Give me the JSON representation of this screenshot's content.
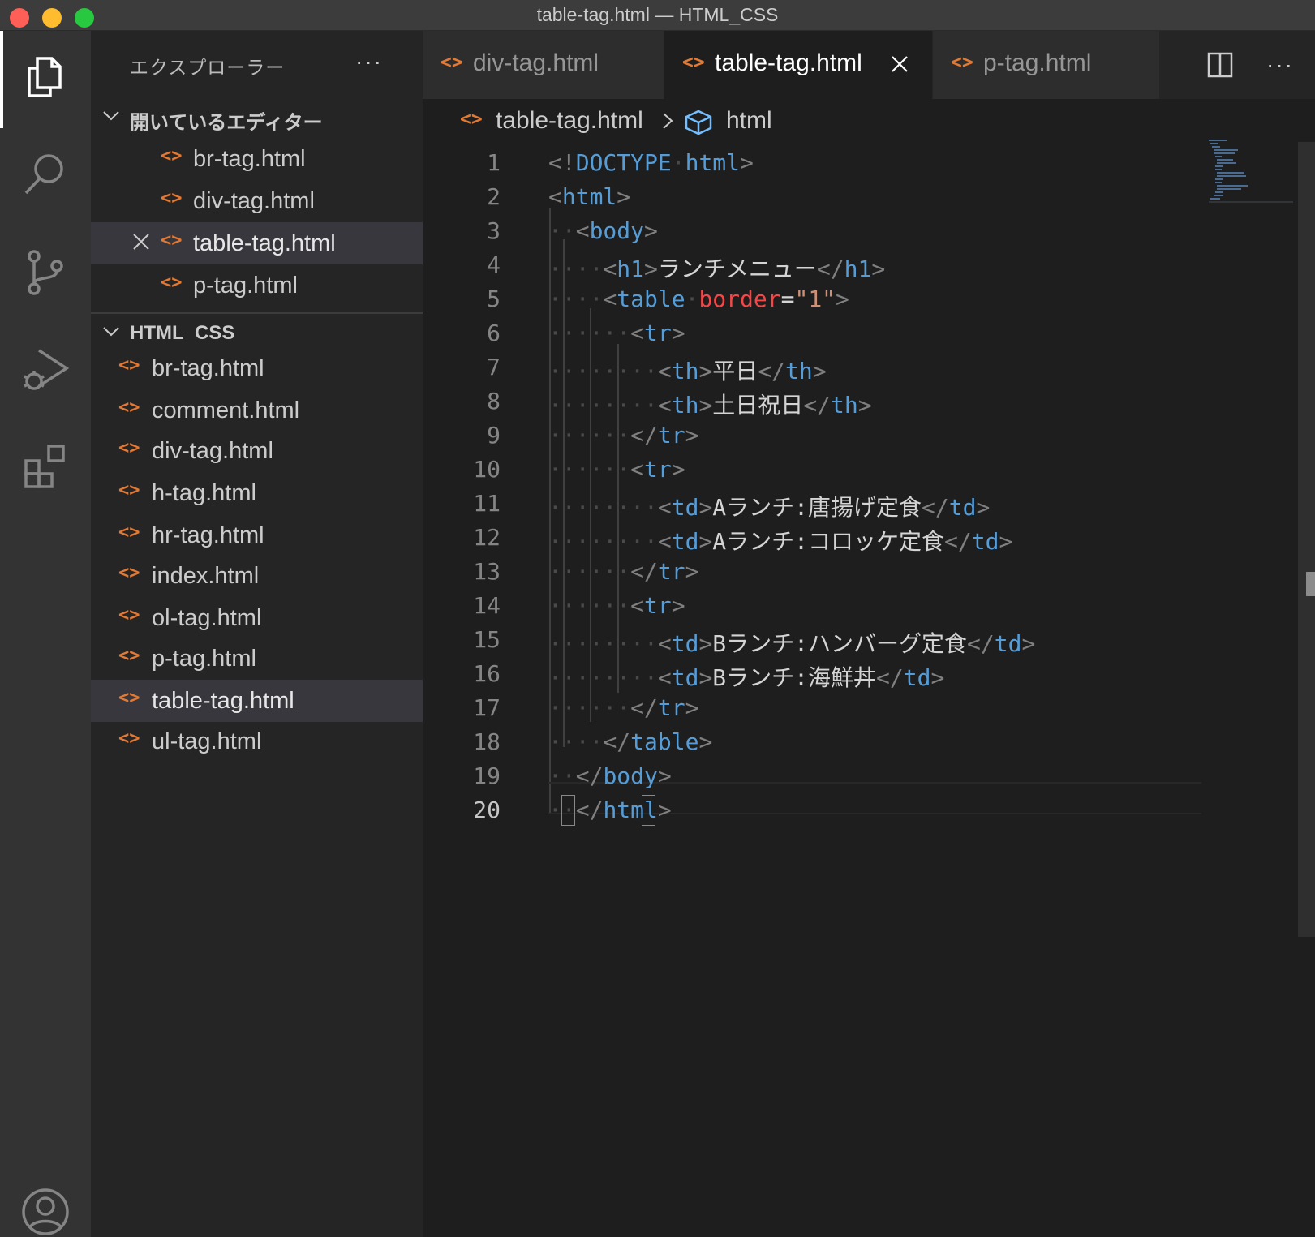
{
  "window": {
    "title": "table-tag.html — HTML_CSS"
  },
  "activity_bar": {
    "items": [
      "explorer-icon",
      "search-icon",
      "source-control-icon",
      "run-debug-icon",
      "extensions-icon",
      "account-icon"
    ],
    "active": "explorer-icon"
  },
  "sidebar": {
    "header": "エクスプローラー",
    "more": "···",
    "open_editors": {
      "title": "開いているエディター",
      "items": [
        "br-tag.html",
        "div-tag.html",
        "table-tag.html",
        "p-tag.html"
      ],
      "active": "table-tag.html"
    },
    "workspace": {
      "title": "HTML_CSS",
      "items": [
        "br-tag.html",
        "comment.html",
        "div-tag.html",
        "h-tag.html",
        "hr-tag.html",
        "index.html",
        "ol-tag.html",
        "p-tag.html",
        "table-tag.html",
        "ul-tag.html"
      ],
      "selected": "table-tag.html"
    },
    "file_icon": "<>"
  },
  "tabs": {
    "items": [
      "div-tag.html",
      "table-tag.html",
      "p-tag.html"
    ],
    "active": "table-tag.html",
    "more": "···"
  },
  "breadcrumb": {
    "file": "table-tag.html",
    "node": "html"
  },
  "editor": {
    "line_numbers": [
      "1",
      "2",
      "3",
      "4",
      "5",
      "6",
      "7",
      "8",
      "9",
      "10",
      "11",
      "12",
      "13",
      "14",
      "15",
      "16",
      "17",
      "18",
      "19",
      "20"
    ],
    "current_line": "20",
    "lines": [
      "<!DOCTYPE html>",
      "<html>",
      "<body>",
      "<h1>ランチメニュー</h1>",
      "<table border=\"1\">",
      "<tr>",
      "<th>平日</th>",
      "<th>土日祝日</th>",
      "</tr>",
      "<tr>",
      "<td>Aランチ:唐揚げ定食</td>",
      "<td>Aランチ:コロッケ定食</td>",
      "</tr>",
      "<tr>",
      "<td>Bランチ:ハンバーグ定食</td>",
      "<td>Bランチ:海鮮丼</td>",
      "</tr>",
      "</table>",
      "</body>",
      "</html>"
    ]
  },
  "colors": {
    "tag": "#569cd6",
    "attribute": "#f44747",
    "string": "#ce9178",
    "file_icon": "#e37933",
    "selection": "#37373d"
  }
}
